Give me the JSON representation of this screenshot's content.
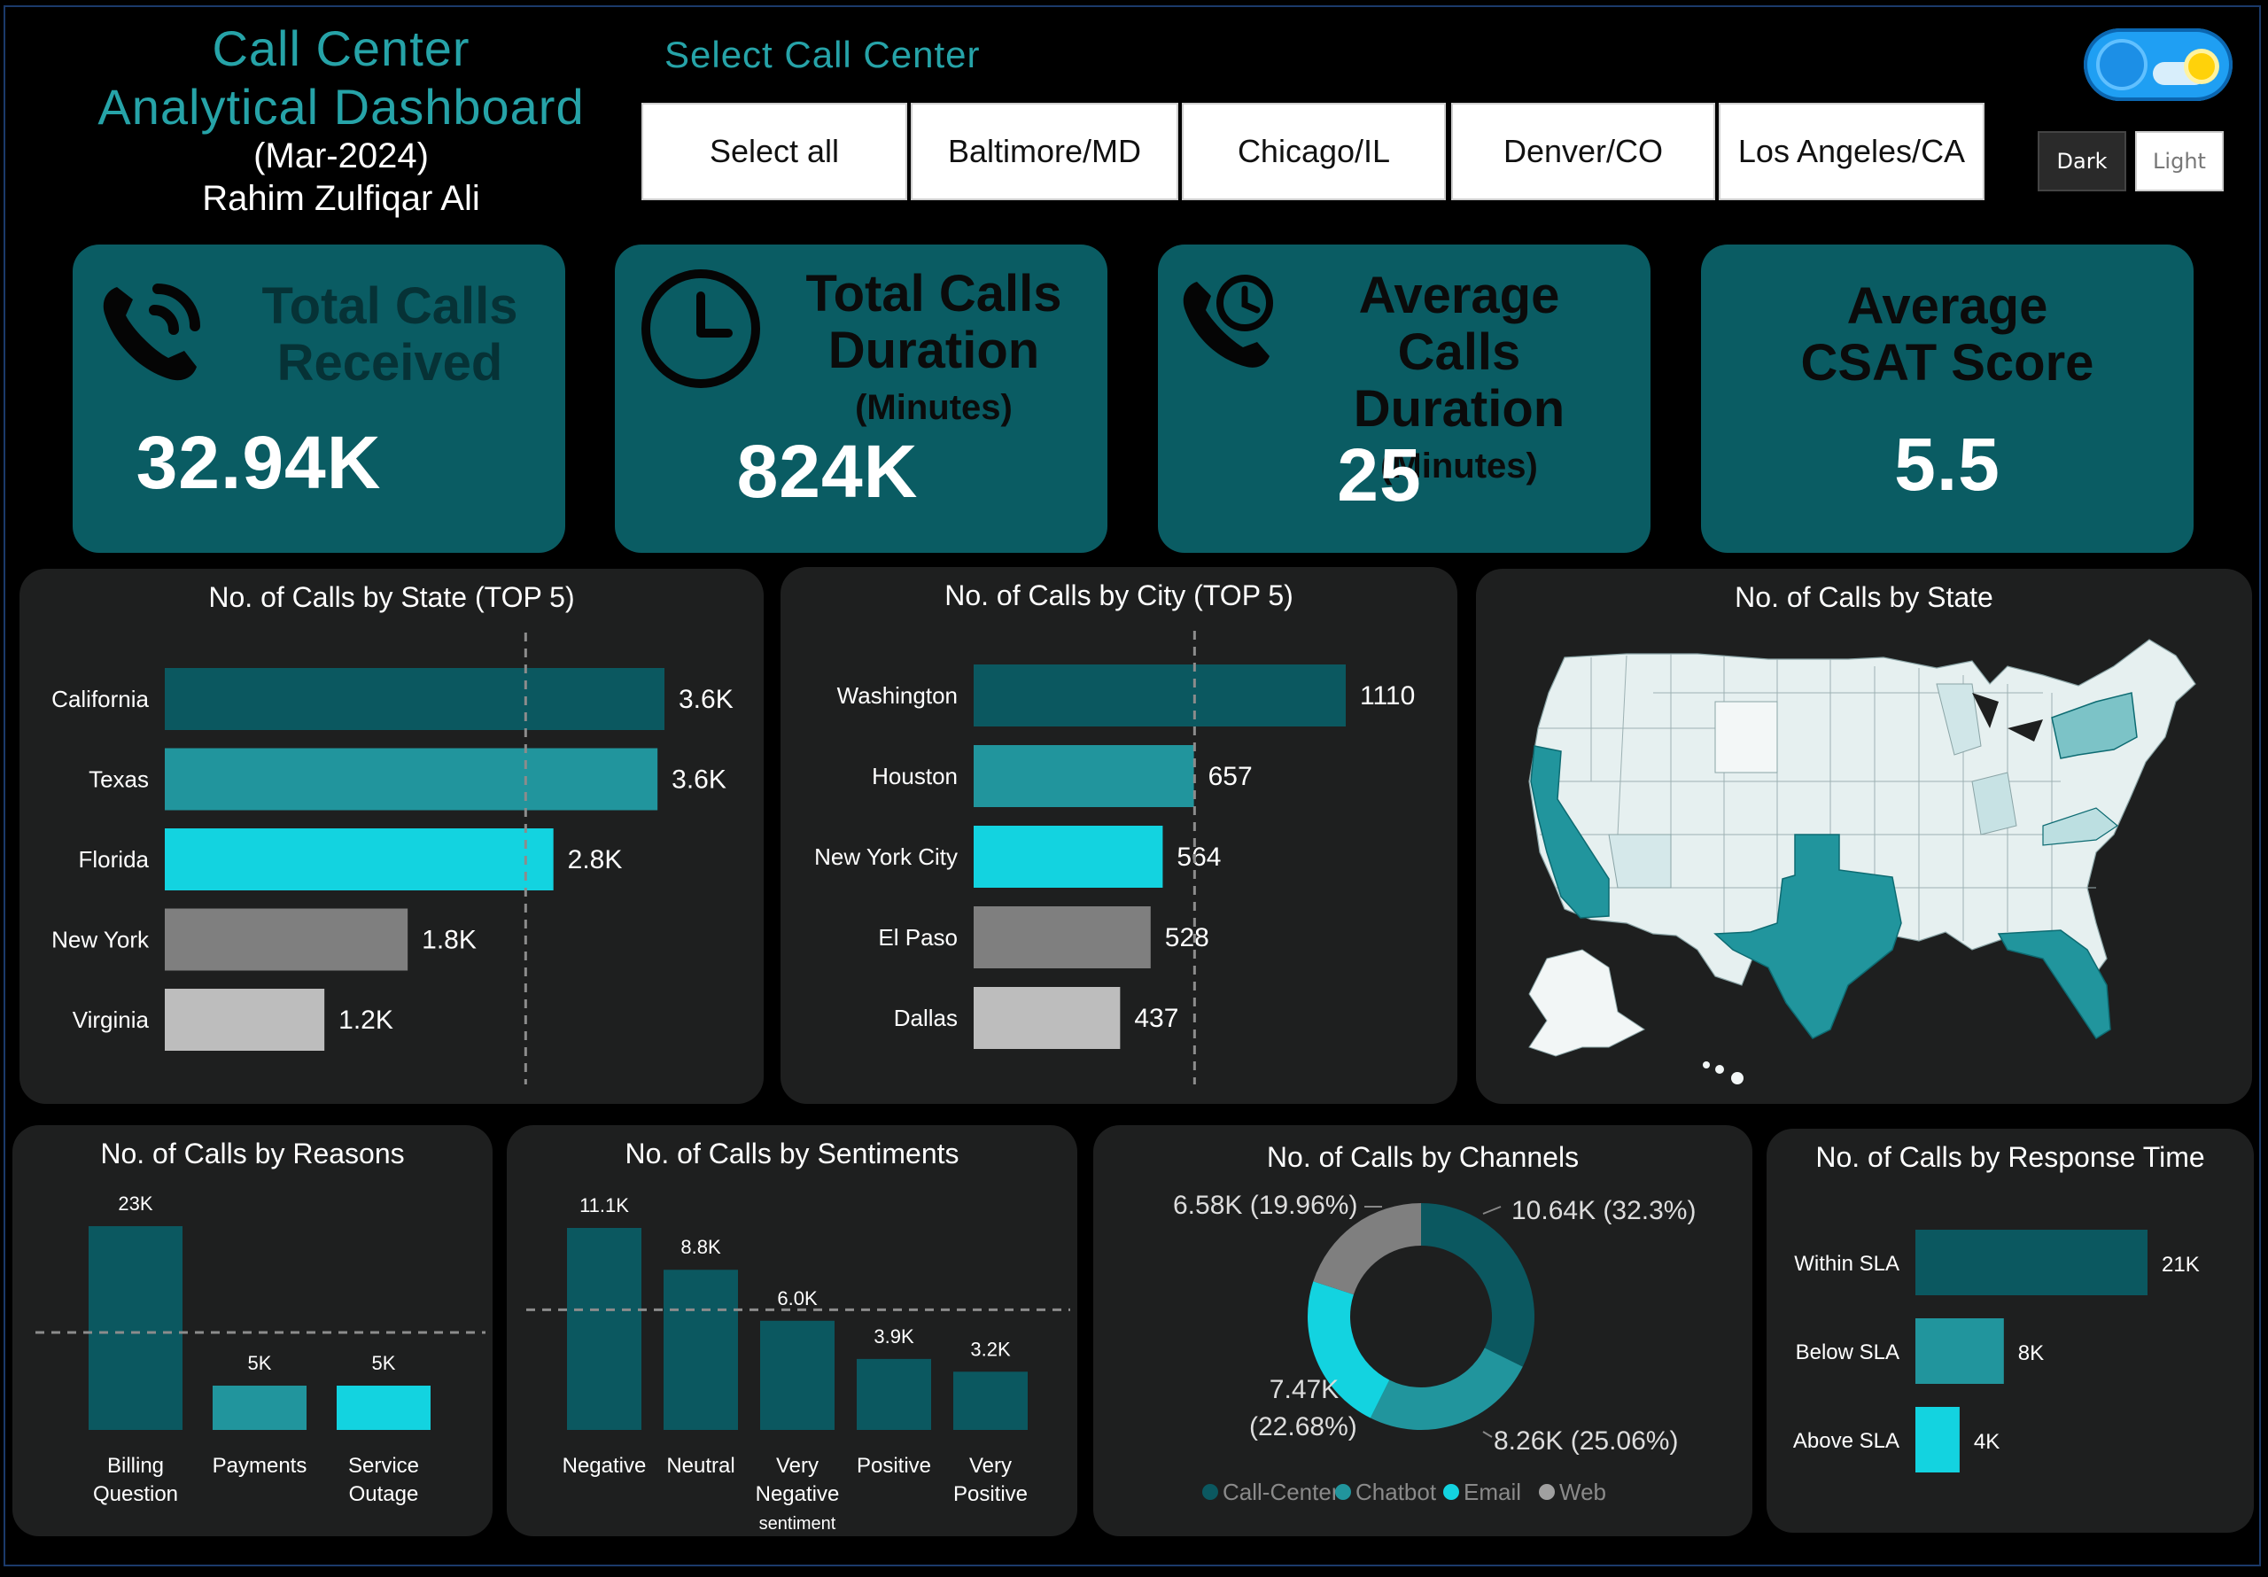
{
  "header": {
    "title_line1": "Call Center",
    "title_line2": "Analytical Dashboard",
    "period": "(Mar-2024)",
    "author": "Rahim Zulfiqar Ali",
    "select_label": "Select Call Center"
  },
  "slicer": {
    "options": [
      "Select all",
      "Baltimore/MD",
      "Chicago/IL",
      "Denver/CO",
      "Los Angeles/CA"
    ]
  },
  "theme": {
    "dark_label": "Dark",
    "light_label": "Light",
    "selected": "Dark"
  },
  "kpis": {
    "total_calls": {
      "title_line1": "Total Calls",
      "title_line2": "Received",
      "value": "32.94K",
      "icon": "phone-ringing-icon"
    },
    "total_duration": {
      "title_line1": "Total Calls",
      "title_line2": "Duration",
      "title_line3": "(Minutes)",
      "value": "824K",
      "icon": "clock-icon"
    },
    "avg_duration": {
      "title_line1": "Average Calls",
      "title_line2": "Duration",
      "title_line3": "(Minutes)",
      "value": "25",
      "icon": "phone-clock-icon"
    },
    "csat": {
      "title_line1": "Average",
      "title_line2": "CSAT Score",
      "value": "5.5"
    }
  },
  "panels": {
    "state": "No. of Calls by State (TOP 5)",
    "city": "No. of Calls by City (TOP 5)",
    "map": "No. of Calls by State",
    "reasons": "No. of Calls by Reasons",
    "sentiments": "No. of Calls by Sentiments",
    "channels": "No. of Calls by Channels",
    "response": "No. of Calls by Response Time"
  },
  "colors": {
    "dark_teal": "#0b5860",
    "teal": "#21959d",
    "cyan": "#13d3e0",
    "gray": "#7f7f7f",
    "light_gray": "#bdbdbd",
    "card": "#0a5c63",
    "panel": "#1e1f1f",
    "accent_text": "#26a3a8"
  },
  "chart_data": [
    {
      "type": "bar",
      "orientation": "horizontal",
      "categories": [
        "California",
        "Texas",
        "Florida",
        "New York",
        "Virginia"
      ],
      "values": [
        3600,
        3550,
        2800,
        1750,
        1150
      ],
      "labels": [
        "3.6K",
        "3.6K",
        "2.8K",
        "1.8K",
        "1.2K"
      ],
      "colors": [
        "#0b5860",
        "#21959d",
        "#13d3e0",
        "#7f7f7f",
        "#bdbdbd"
      ],
      "average_line": 2600,
      "xlim": [
        0,
        3600
      ]
    },
    {
      "type": "bar",
      "orientation": "horizontal",
      "categories": [
        "Washington",
        "Houston",
        "New York City",
        "El Paso",
        "Dallas"
      ],
      "values": [
        1110,
        657,
        564,
        528,
        437
      ],
      "labels": [
        "1110",
        "657",
        "564",
        "528",
        "437"
      ],
      "colors": [
        "#0b5860",
        "#21959d",
        "#13d3e0",
        "#7f7f7f",
        "#bdbdbd"
      ],
      "average_line": 659,
      "xlim": [
        0,
        1110
      ]
    },
    {
      "type": "bar",
      "categories": [
        "Billing Question",
        "Payments",
        "Service Outage"
      ],
      "category_lines": [
        [
          "Billing",
          "Question"
        ],
        [
          "Payments"
        ],
        [
          "Service",
          "Outage"
        ]
      ],
      "values": [
        23000,
        5000,
        5000
      ],
      "labels": [
        "23K",
        "5K",
        "5K"
      ],
      "colors": [
        "#0b5860",
        "#21959d",
        "#13d3e0"
      ],
      "average_line": 11000,
      "ylim": [
        0,
        23000
      ]
    },
    {
      "type": "bar",
      "categories": [
        "Negative",
        "Neutral",
        "Very Negative sentiment",
        "Positive",
        "Very Positive"
      ],
      "category_lines": [
        [
          "Negative"
        ],
        [
          "Neutral"
        ],
        [
          "Very",
          "Negative",
          "sentiment"
        ],
        [
          "Positive"
        ],
        [
          "Very",
          "Positive"
        ]
      ],
      "values": [
        11100,
        8800,
        6000,
        3900,
        3200
      ],
      "labels": [
        "11.1K",
        "8.8K",
        "6.0K",
        "3.9K",
        "3.2K"
      ],
      "colors": [
        "#0b5860",
        "#0b5860",
        "#0b5860",
        "#0b5860",
        "#0b5860"
      ],
      "average_line": 6600,
      "ylim": [
        0,
        11100
      ]
    },
    {
      "type": "pie",
      "donut": true,
      "categories": [
        "Call-Center",
        "Chatbot",
        "Email",
        "Web"
      ],
      "values": [
        10640,
        8260,
        7470,
        6580
      ],
      "percents": [
        32.3,
        25.06,
        22.68,
        19.96
      ],
      "labels": [
        "10.64K (32.3%)",
        "8.26K (25.06%)",
        "7.47K (22.68%)",
        "6.58K (19.96%)"
      ],
      "colors": [
        "#0b5860",
        "#21959d",
        "#13d3e0",
        "#7f7f7f"
      ],
      "legend": "bottom"
    },
    {
      "type": "bar",
      "orientation": "horizontal",
      "categories": [
        "Within SLA",
        "Below SLA",
        "Above SLA"
      ],
      "values": [
        21000,
        8000,
        4000
      ],
      "labels": [
        "21K",
        "8K",
        "4K"
      ],
      "colors": [
        "#0b5860",
        "#21959d",
        "#13d3e0"
      ],
      "xlim": [
        0,
        21000
      ]
    },
    {
      "type": "map",
      "region": "United States",
      "highlighted_states": [
        "California",
        "Texas",
        "Florida",
        "New York",
        "Virginia"
      ]
    }
  ]
}
